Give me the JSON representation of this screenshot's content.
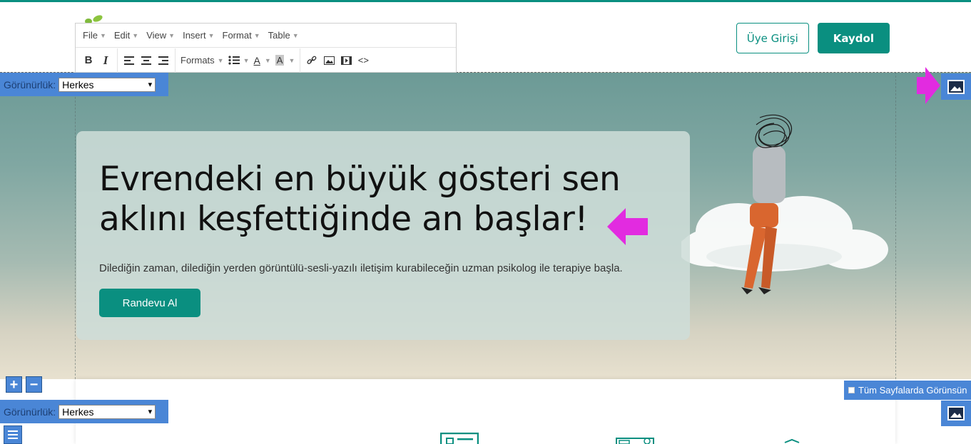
{
  "header": {
    "login_label": "Üye Girişi",
    "signup_label": "Kaydol"
  },
  "editor": {
    "menu": [
      {
        "label": "File"
      },
      {
        "label": "Edit"
      },
      {
        "label": "View"
      },
      {
        "label": "Insert"
      },
      {
        "label": "Format"
      },
      {
        "label": "Table"
      }
    ],
    "formats_label": "Formats",
    "bold_label": "B",
    "italic_label": "I",
    "font_color_label": "A",
    "bg_color_label": "A",
    "source_label": "<>"
  },
  "visibility": {
    "label": "Görünürlük:",
    "value_top": "Herkes",
    "value_bottom": "Herkes"
  },
  "hero": {
    "title_line1": "Evrendeki en büyük gösteri sen",
    "title_line2": "aklını keşfettiğinde an başlar!",
    "subtitle": "Dilediğin zaman, dilediğin yerden görüntülü-sesli-yazılı iletişim kurabileceğin uzman psikolog ile terapiye başla.",
    "cta_label": "Randevu Al"
  },
  "section_controls": {
    "add_label": "+",
    "remove_label": "−",
    "all_pages_label": "Tüm Sayfalarda Görünsün"
  },
  "colors": {
    "accent": "#0a8f80",
    "editor_blue": "#4a86d6",
    "arrow_magenta": "#e22be0"
  }
}
